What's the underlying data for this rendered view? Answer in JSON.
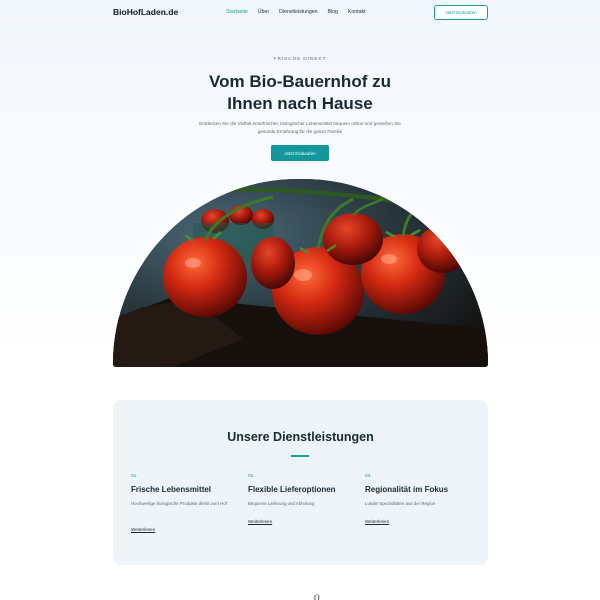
{
  "header": {
    "logo": "BioHofLaden.de",
    "nav": [
      "Startseite",
      "Über",
      "Dienstleistungen",
      "Blog",
      "Kontakt"
    ],
    "cta": "Jetzt Einkaufen"
  },
  "hero": {
    "eyebrow": "FRISCHE DIREKT",
    "title_line1": "Vom Bio-Bauernhof zu",
    "title_line2": "Ihnen nach Hause",
    "desc_line1": "Entdecken Sie die Vielfalt erntefrischer, biologischer Lebensmittel bequem online und genießen Sie",
    "desc_line2": "gesunde Ernährung für die ganze Familie",
    "button": "Jetzt Einkaufen"
  },
  "services": {
    "title": "Unsere Dienstleistungen",
    "items": [
      {
        "num": "01.",
        "title": "Frische Lebensmittel",
        "desc": "Hochwertige biologische Produkte direkt vom Hof",
        "link": "Weiterlesen"
      },
      {
        "num": "02.",
        "title": "Flexible Lieferoptionen",
        "desc": "Bequeme Lieferung und Abholung",
        "link": "Weiterlesen"
      },
      {
        "num": "03.",
        "title": "Regionalität im Fokus",
        "desc": "Lokale Spezialitäten aus der Region",
        "link": "Weiterlesen"
      }
    ]
  },
  "footer_hint": "Ü",
  "colors": {
    "accent": "#16a19b",
    "button": "#14979a",
    "text": "#1a2a33",
    "panel": "#eef4f8"
  }
}
